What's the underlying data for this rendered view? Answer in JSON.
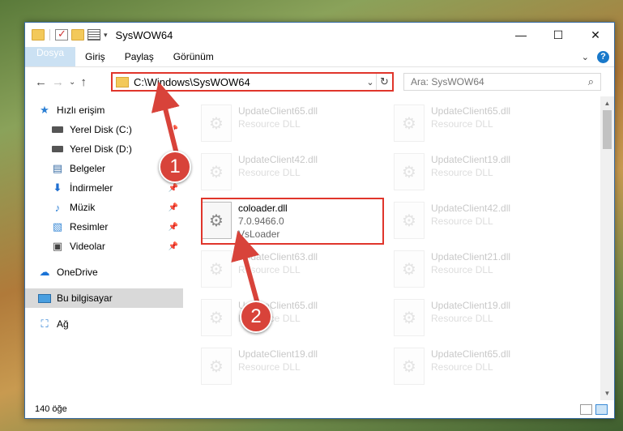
{
  "window": {
    "title": "SysWOW64",
    "controls": {
      "minimize": "—",
      "maximize": "☐",
      "close": "✕"
    }
  },
  "ribbon": {
    "tabs": [
      "Dosya",
      "Giriş",
      "Paylaş",
      "Görünüm"
    ],
    "expand": "⌄",
    "help": "?"
  },
  "address": {
    "path": "C:\\Windows\\SysWOW64",
    "search_placeholder": "Ara: SysWOW64"
  },
  "nav_pane": {
    "quick_access": "Hızlı erişim",
    "items": [
      {
        "label": "Yerel Disk (C:)",
        "icon": "drive-icon"
      },
      {
        "label": "Yerel Disk (D:)",
        "icon": "drive-icon"
      },
      {
        "label": "Belgeler",
        "icon": "documents-icon"
      },
      {
        "label": "İndirmeler",
        "icon": "downloads-icon"
      },
      {
        "label": "Müzik",
        "icon": "music-icon"
      },
      {
        "label": "Resimler",
        "icon": "pictures-icon"
      },
      {
        "label": "Videolar",
        "icon": "videos-icon"
      }
    ],
    "onedrive": "OneDrive",
    "this_pc": "Bu bilgisayar",
    "network": "Ağ"
  },
  "files": [
    {
      "name": "UpdateClient65.dll",
      "sub": "Resource DLL"
    },
    {
      "name": "UpdateClient65.dll",
      "sub": "Resource DLL"
    },
    {
      "name": "UpdateClient42.dll",
      "sub": "Resource DLL"
    },
    {
      "name": "UpdateClient19.dll",
      "sub": "Resource DLL"
    },
    {
      "name": "coloader.dll",
      "sub": "7.0.9466.0",
      "sub2": "VsLoader"
    },
    {
      "name": "UpdateClient42.dll",
      "sub": "Resource DLL"
    },
    {
      "name": "UpdateClient63.dll",
      "sub": "Resource DLL"
    },
    {
      "name": "UpdateClient21.dll",
      "sub": "Resource DLL"
    },
    {
      "name": "UpdateClient65.dll",
      "sub": "Resource DLL"
    },
    {
      "name": "UpdateClient19.dll",
      "sub": "Resource DLL"
    },
    {
      "name": "UpdateClient19.dll",
      "sub": "Resource DLL"
    },
    {
      "name": "UpdateClient65.dll",
      "sub": "Resource DLL"
    }
  ],
  "status": {
    "count": "140 öğe"
  },
  "annotations": {
    "one": "1",
    "two": "2"
  },
  "colors": {
    "accent": "#1979ca",
    "highlight": "#e0352b"
  }
}
